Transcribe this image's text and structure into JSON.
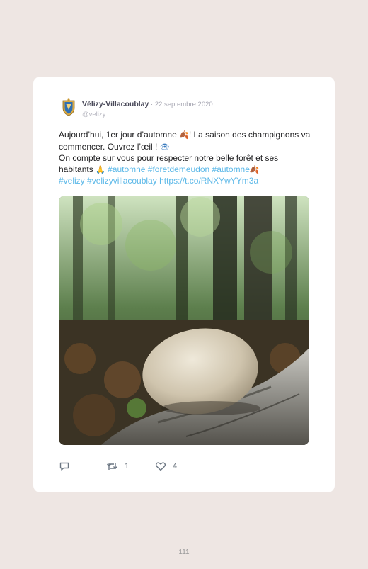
{
  "tweet": {
    "author": {
      "display_name": "Vélizy-Villacoublay",
      "date": "22 septembre 2020",
      "separator": " · ",
      "handle": "@velizy"
    },
    "text": {
      "line1_a": "Aujourd’hui, 1er jour d’automne ",
      "line1_b": "! La saison des champignons va commencer. Ouvrez l’œil ! ",
      "line2": "On compte sur vous pour respecter notre belle forêt et ses habitants ",
      "hashtags_1": "#automne #foretdemeudon #automne",
      "hashtags_2": "#velizy #velizyvillacoublay",
      "link": "https://t.co/RNXYwYYm3a"
    },
    "emoji": {
      "leaves": "🍂",
      "eye": "👁",
      "pray": "🙏"
    },
    "image_alt": "mushroom-on-log-in-forest",
    "actions": {
      "reply_count": "",
      "retweet_count": "1",
      "like_count": "4"
    }
  },
  "page": {
    "number": "111"
  },
  "colors": {
    "background": "#eee6e3",
    "card": "#ffffff",
    "link": "#5bb8e8",
    "icon": "#6b7682"
  }
}
